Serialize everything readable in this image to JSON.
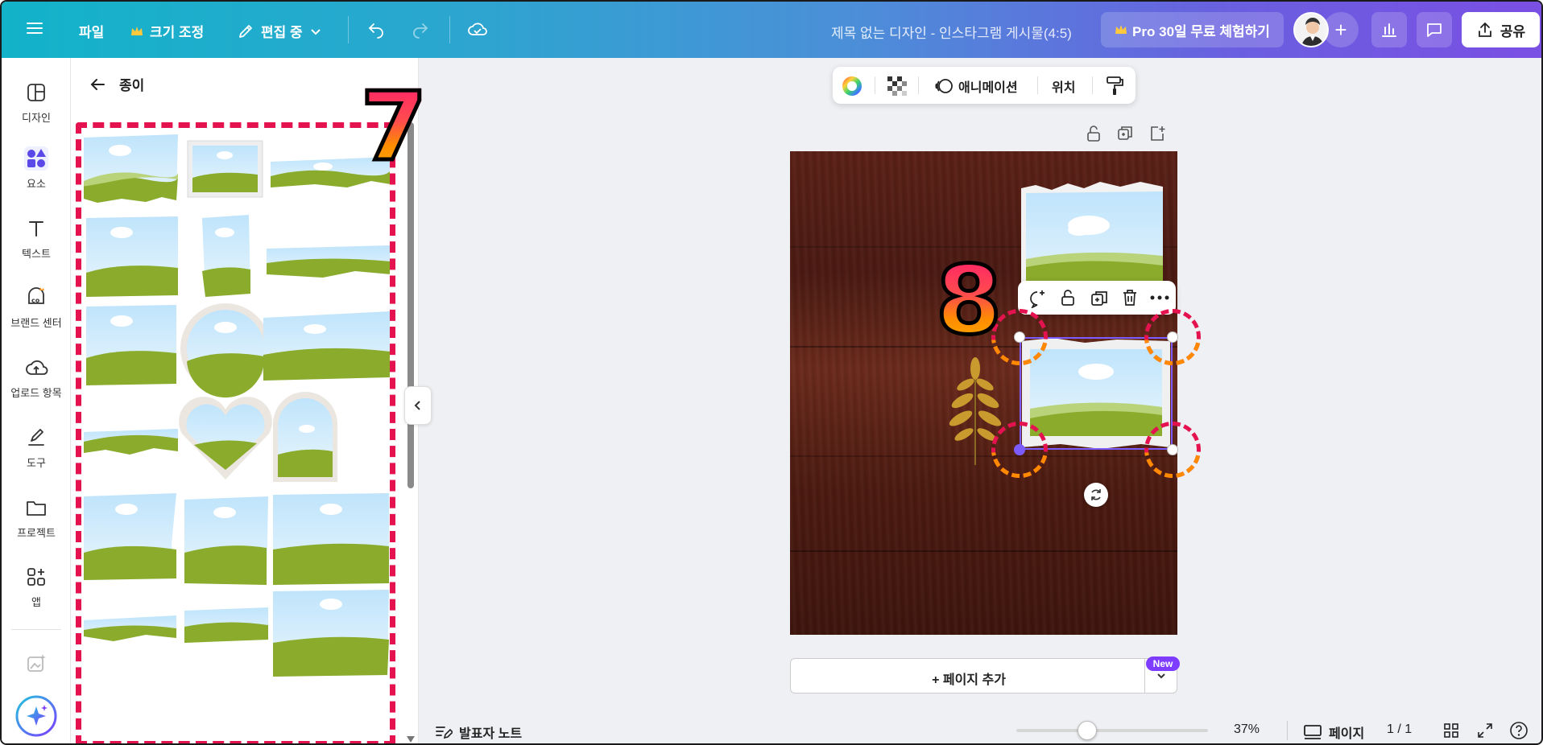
{
  "topbar": {
    "menu_icon": "hamburger-icon",
    "file_label": "파일",
    "resize_label": "크기 조정",
    "editing_label": "편집 중",
    "document_title": "제목 없는 디자인 - 인스타그램 게시물(4:5)",
    "pro_trial_label": "Pro 30일 무료 체험하기",
    "share_label": "공유",
    "crown_color": "#ffc83d"
  },
  "rail": {
    "items": [
      {
        "label": "디자인",
        "icon": "layout-icon"
      },
      {
        "label": "요소",
        "icon": "shapes-icon"
      },
      {
        "label": "텍스트",
        "icon": "text-icon"
      },
      {
        "label": "브랜드 센터",
        "icon": "brand-icon"
      },
      {
        "label": "업로드 항목",
        "icon": "cloud-upload-icon"
      },
      {
        "label": "도구",
        "icon": "pen-tool-icon"
      },
      {
        "label": "프로젝트",
        "icon": "folder-icon"
      },
      {
        "label": "앱",
        "icon": "apps-icon"
      }
    ]
  },
  "panel": {
    "title": "종이",
    "annotation_number": "7"
  },
  "float_toolbar": {
    "animation_label": "애니메이션",
    "position_label": "위치"
  },
  "canvas": {
    "annotation_number": "8",
    "selection_color": "#7d5cff"
  },
  "add_page": {
    "label": "+ 페이지 추가",
    "badge": "New"
  },
  "bottombar": {
    "notes_label": "발표자 노트",
    "zoom_value": "37%",
    "zoom_level": 0.37,
    "pages_label": "페이지",
    "page_counter": "1 / 1"
  }
}
